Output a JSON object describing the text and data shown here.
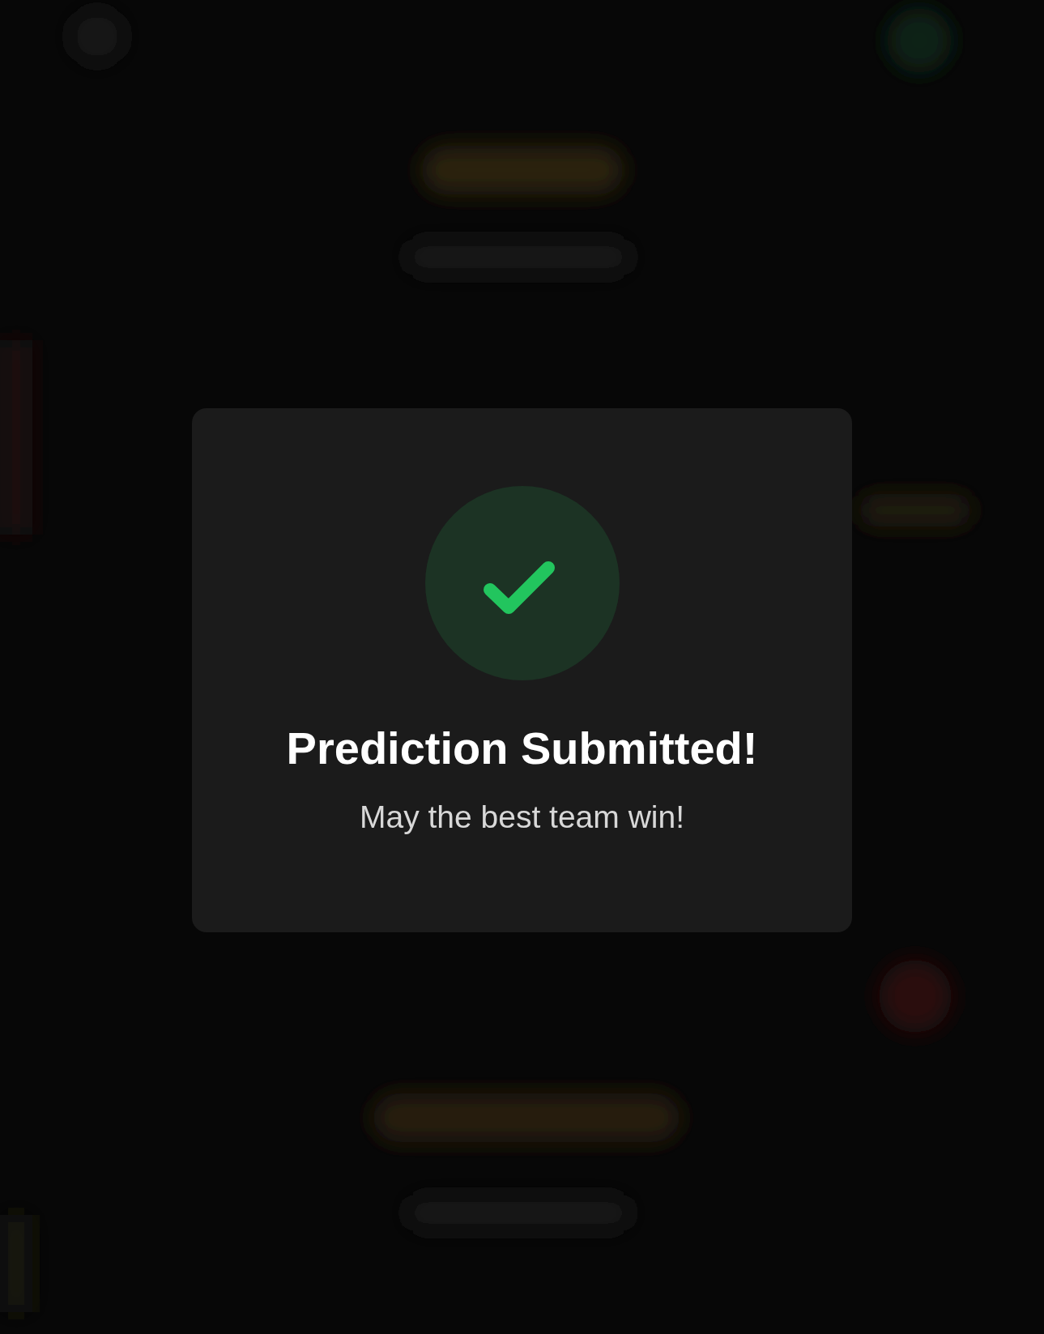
{
  "dialog": {
    "title": "Prediction Submitted!",
    "message": "May the best team win!"
  }
}
